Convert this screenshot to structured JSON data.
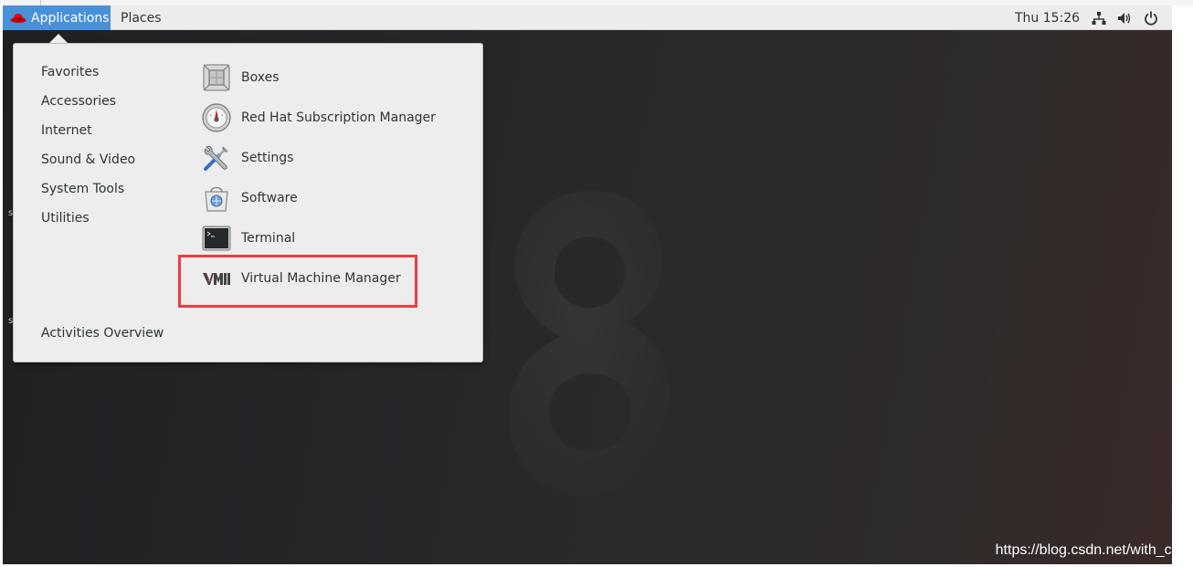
{
  "panel": {
    "applications_label": "Applications",
    "places_label": "Places",
    "clock": "Thu 15:26"
  },
  "menu": {
    "categories": [
      {
        "label": "Favorites"
      },
      {
        "label": "Accessories"
      },
      {
        "label": "Internet"
      },
      {
        "label": "Sound & Video"
      },
      {
        "label": "System Tools"
      },
      {
        "label": "Utilities"
      }
    ],
    "apps": [
      {
        "label": "Boxes",
        "icon": "boxes-icon"
      },
      {
        "label": "Red Hat Subscription Manager",
        "icon": "subscription-manager-icon"
      },
      {
        "label": "Settings",
        "icon": "settings-icon"
      },
      {
        "label": "Software",
        "icon": "software-icon"
      },
      {
        "label": "Terminal",
        "icon": "terminal-icon"
      },
      {
        "label": "Virtual Machine Manager",
        "icon": "virt-manager-icon"
      }
    ],
    "activities_overview": "Activities Overview",
    "highlighted_item": "Virtual Machine Manager"
  },
  "desktop": {
    "wallpaper_numeral": "8"
  },
  "watermark": "https://blog.csdn.net/with_cat",
  "colors": {
    "accent": "#4a90d9",
    "highlight": "#ef3b3b",
    "menu_bg": "#ededed"
  }
}
